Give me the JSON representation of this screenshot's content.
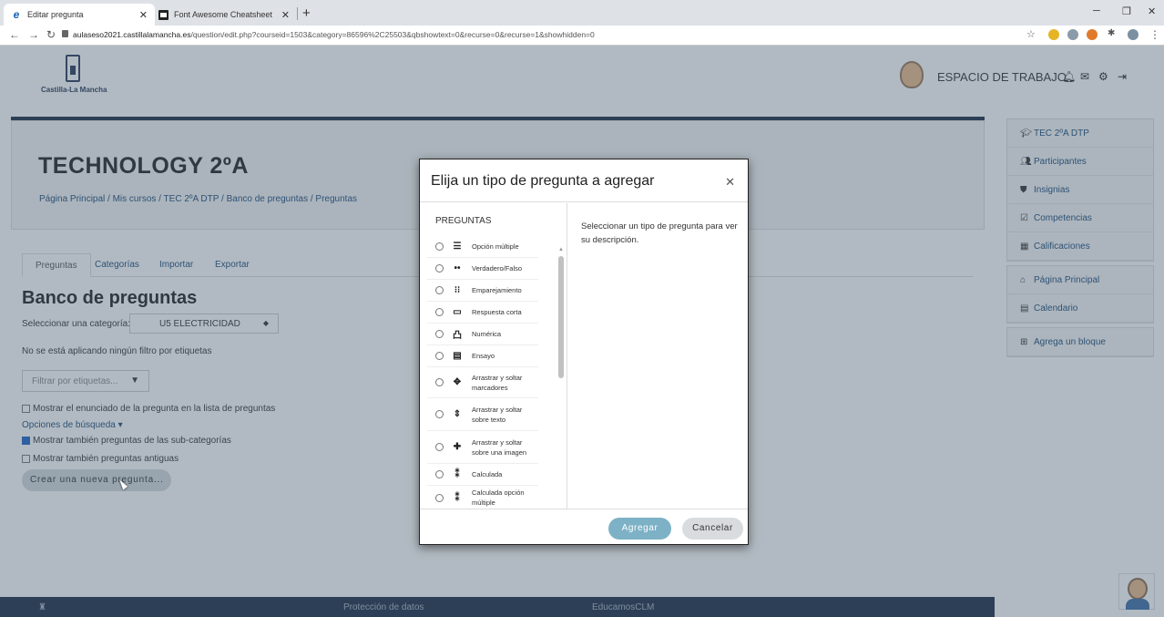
{
  "browser": {
    "tabs": [
      {
        "title": "Editar pregunta",
        "active": true
      },
      {
        "title": "Font Awesome Cheatsheet",
        "active": false
      }
    ],
    "url_host": "aulaseso2021.castillalamancha.es",
    "url_path": "/question/edit.php?courseid=1503&category=86596%2C25503&qbshowtext=0&recurse=0&recurse=1&showhidden=0"
  },
  "header": {
    "logo_text": "Castilla-La Mancha",
    "workspace": "ESPACIO DE TRABAJO"
  },
  "course": {
    "title": "TECHNOLOGY 2ºA",
    "breadcrumb": "Página Principal  /  Mis cursos  /  TEC 2ºA DTP  /  Banco de preguntas  /  Preguntas"
  },
  "tabs": {
    "preguntas": "Preguntas",
    "categorias": "Categorías",
    "importar": "Importar",
    "exportar": "Exportar"
  },
  "bank": {
    "title": "Banco de preguntas",
    "category_label": "Seleccionar una categoría:",
    "category_value": "U5 ELECTRICIDAD",
    "no_filter": "No se está aplicando ningún filtro por etiquetas",
    "tag_filter_placeholder": "Filtrar por etiquetas...",
    "show_text": "Mostrar el enunciado de la pregunta en la lista de preguntas",
    "search_options": "Opciones de búsqueda",
    "show_subcats": "Mostrar también preguntas de las sub-categorías",
    "show_old": "Mostrar también preguntas antiguas",
    "create_button": "Crear una nueva pregunta..."
  },
  "sidebar": {
    "items": [
      {
        "label": "TEC 2ºA DTP",
        "icon": "graduation-cap-icon"
      },
      {
        "label": "Participantes",
        "icon": "users-icon"
      },
      {
        "label": "Insignias",
        "icon": "shield-icon"
      },
      {
        "label": "Competencias",
        "icon": "check-square-icon"
      },
      {
        "label": "Calificaciones",
        "icon": "table-icon"
      },
      {
        "label": "Página Principal",
        "icon": "home-icon"
      },
      {
        "label": "Calendario",
        "icon": "calendar-icon"
      },
      {
        "label": "Agrega un bloque",
        "icon": "plus-square-icon"
      }
    ]
  },
  "footer": {
    "privacy": "Protección de datos",
    "brand": "EducamosCLM"
  },
  "modal": {
    "title": "Elija un tipo de pregunta a agregar",
    "section": "PREGUNTAS",
    "description": "Seleccionar un tipo de pregunta para ver su descripción.",
    "add": "Agregar",
    "cancel": "Cancelar",
    "questions": [
      "Opción múltiple",
      "Verdadero/Falso",
      "Emparejamiento",
      "Respuesta corta",
      "Numérica",
      "Ensayo",
      "Arrastrar y soltar marcadores",
      "Arrastrar y soltar sobre texto",
      "Arrastrar y soltar sobre una imagen",
      "Calculada",
      "Calculada opción múltiple"
    ]
  }
}
